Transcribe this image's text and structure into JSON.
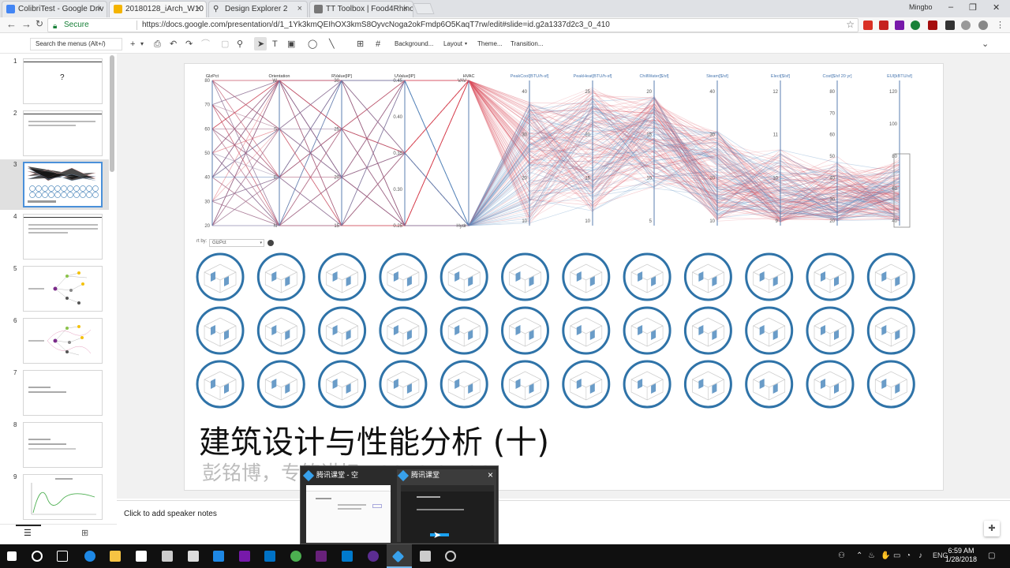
{
  "browser": {
    "tabs": [
      {
        "title": "ColibriTest - Google Driv",
        "fav_color": "#4285f4",
        "active": false
      },
      {
        "title": "20180128_iArch_W10 - G",
        "fav_color": "#f4b400",
        "active": true
      },
      {
        "title": "Design Explorer 2",
        "fav_color": "#555555",
        "active": false
      },
      {
        "title": "TT Toolbox | Food4Rhino",
        "fav_color": "#555555",
        "active": false
      }
    ],
    "tab_close": "×",
    "user": "Mingbo",
    "secure_label": "Secure",
    "url": "https://docs.google.com/presentation/d/1_1Yk3kmQEIhOX3kmS8OyvcNoga2okFmdp6O5KaqT7rw/edit#slide=id.g2a1337d2c3_0_410"
  },
  "toolbar": {
    "menu_search_placeholder": "Search the menus (Alt+/)",
    "background": "Background...",
    "layout": "Layout",
    "theme": "Theme...",
    "transition": "Transition..."
  },
  "slide_numbers": [
    "1",
    "2",
    "3",
    "4",
    "5",
    "6",
    "7",
    "8",
    "9"
  ],
  "slide_thumbs": {
    "s1_text": "?"
  },
  "chart": {
    "axes": [
      "GlzPct",
      "Orientation",
      "RValue[IP]",
      "UValue[IP]",
      "HVAC",
      "PeakCool[BTU/h-sf]",
      "PeakHeat[BTU/h-sf]",
      "ChillWater[$/sf]",
      "Steam[$/sf]",
      "Elect[$/sf]",
      "Cost[$/sf 20 yr]",
      "EUI[kBTU/sf]"
    ],
    "filter_label": "rt by:",
    "filter_value": "GlzPct",
    "ticks": {
      "glz": [
        "80",
        "70",
        "60",
        "50",
        "40",
        "30",
        "20"
      ],
      "orient": [
        "W",
        "S",
        "E",
        "N"
      ],
      "rval": [
        "30",
        "25",
        "20",
        "15"
      ],
      "uval": [
        "0.45",
        "0.40",
        "0.35",
        "0.30",
        "0.25"
      ],
      "hvac": [
        "VAV",
        "Hydr"
      ],
      "peakcool": [
        "40",
        "30",
        "20",
        "10"
      ],
      "peakheat": [
        "25",
        "20",
        "15",
        "10"
      ],
      "chill": [
        "20",
        "15",
        "10",
        "5"
      ],
      "steam": [
        "40",
        "30",
        "20",
        "10"
      ],
      "elect": [
        "12",
        "11",
        "10",
        "9"
      ],
      "cost": [
        "80",
        "70",
        "60",
        "50",
        "40",
        "30",
        "20"
      ],
      "eui": [
        "120",
        "100",
        "80",
        "60",
        "40"
      ]
    }
  },
  "slide_title": "建筑设计与性能分析 (十)",
  "slide_subtitle": "彭铭博，专筑讲坛 · 2018.01.28",
  "notes_placeholder": "Click to add speaker notes",
  "popup": {
    "card1": "腾讯课堂 - 空",
    "card2": "腾讯课堂",
    "close": "×"
  },
  "clock": {
    "time": "6:59 AM",
    "date": "1/28/2018"
  },
  "tray_lang": "ENG"
}
